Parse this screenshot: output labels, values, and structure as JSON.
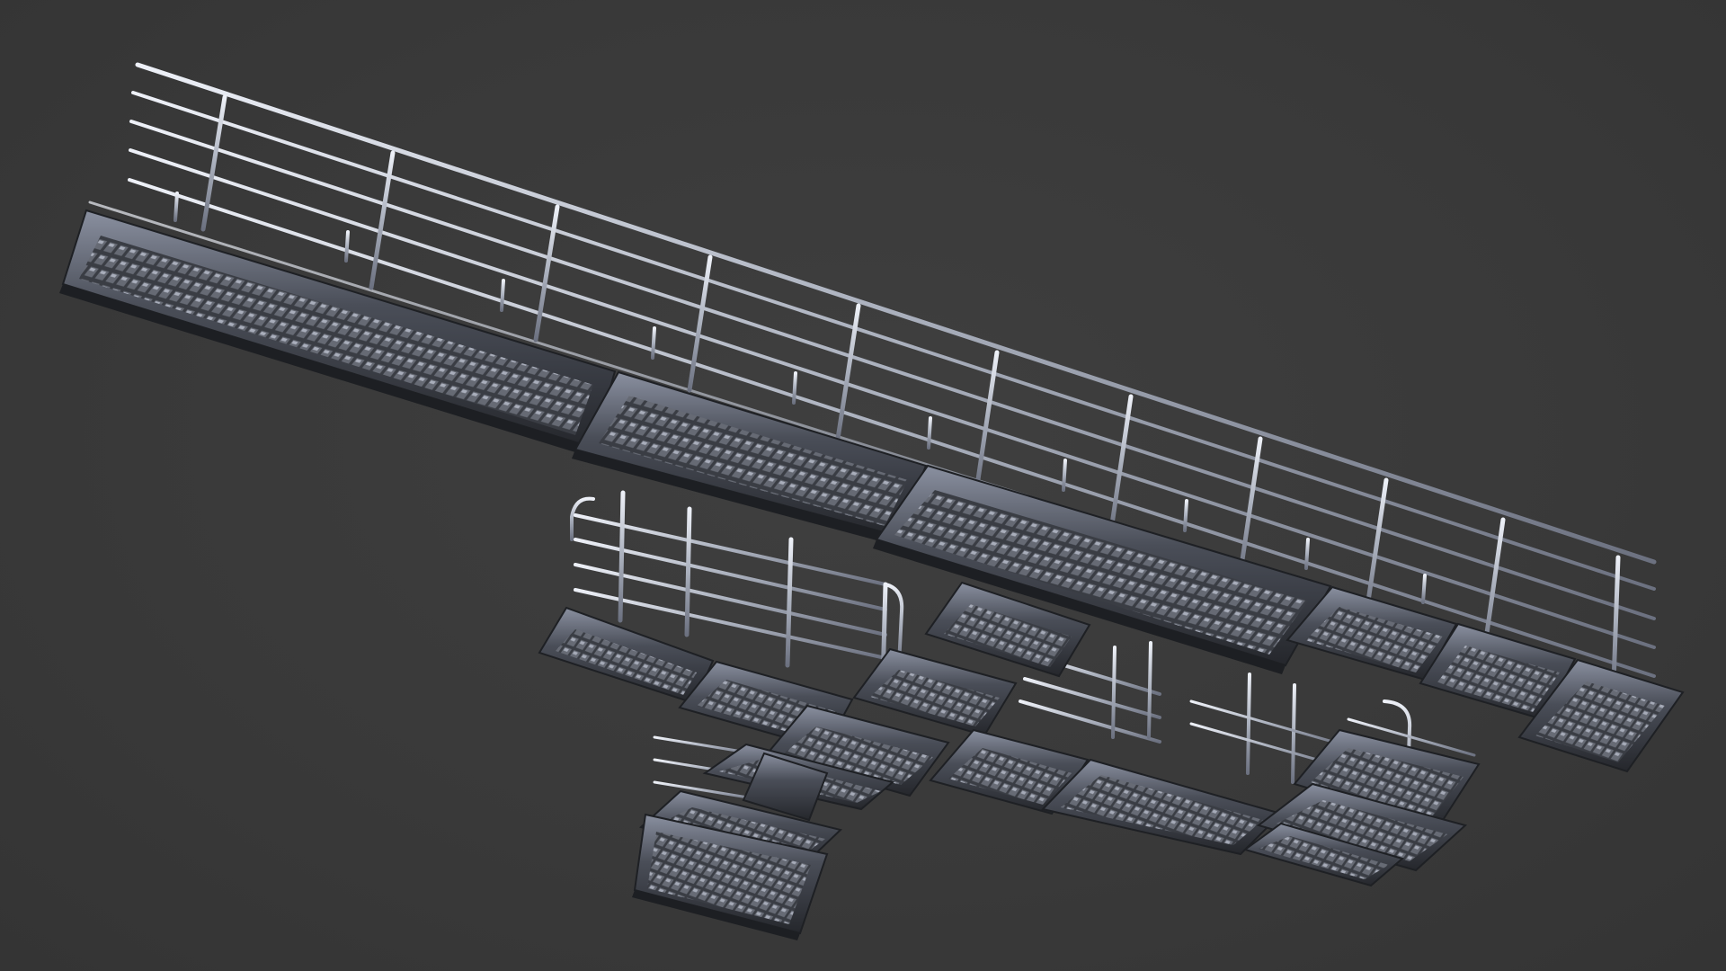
{
  "scene": {
    "subject": "",
    "background_color": "#3b3b3b",
    "colors": {
      "rail": "#b9bdc8",
      "rail_highlight": "#e4e8f2",
      "rail_shadow": "#6f7380",
      "frame": "#2a2c30",
      "frame_edge": "#7d8290",
      "grate": "#5b5e66",
      "grate_light": "#a7acb8"
    }
  }
}
